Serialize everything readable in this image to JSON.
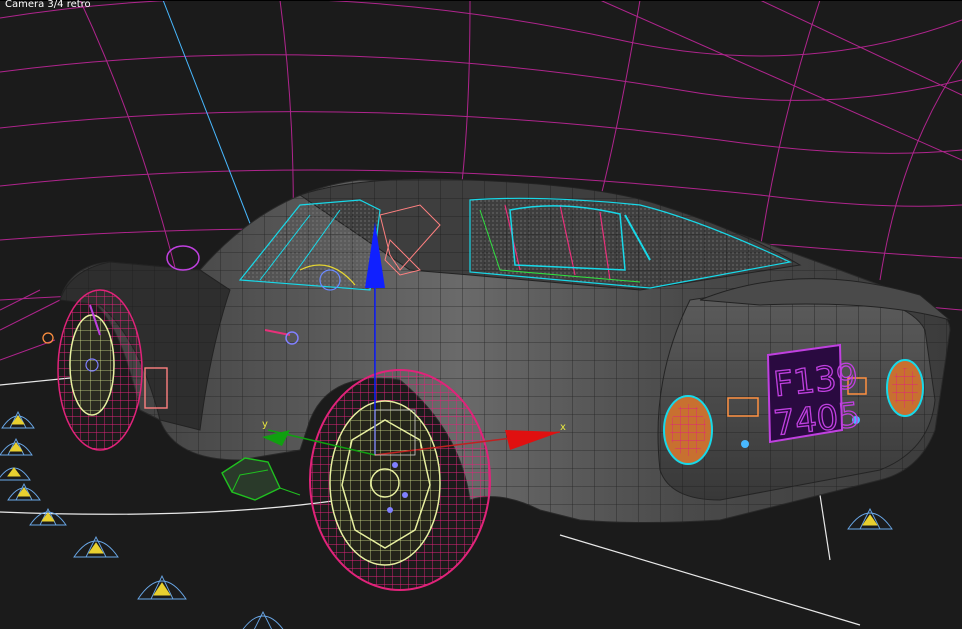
{
  "viewport": {
    "camera_label": "Camera 3/4 retro",
    "plate_line1": "F139",
    "plate_line2": "7405",
    "gizmo_axis_y": "y",
    "gizmo_axis_x": "x"
  },
  "colors": {
    "background": "#1b1b1b",
    "grid": "#c0269a",
    "body_shade": "#555555",
    "wheel_wire": "#e0237a",
    "rim_wire": "#e8f0a0",
    "gizmo_y": "#1020ff",
    "gizmo_x": "#e01010",
    "gizmo_z": "#10a010",
    "light_helpers": "#6aa8e8",
    "cyan_wire": "#18d8e8"
  },
  "icons": [
    "light-helper-icon",
    "transform-gizmo-icon"
  ]
}
